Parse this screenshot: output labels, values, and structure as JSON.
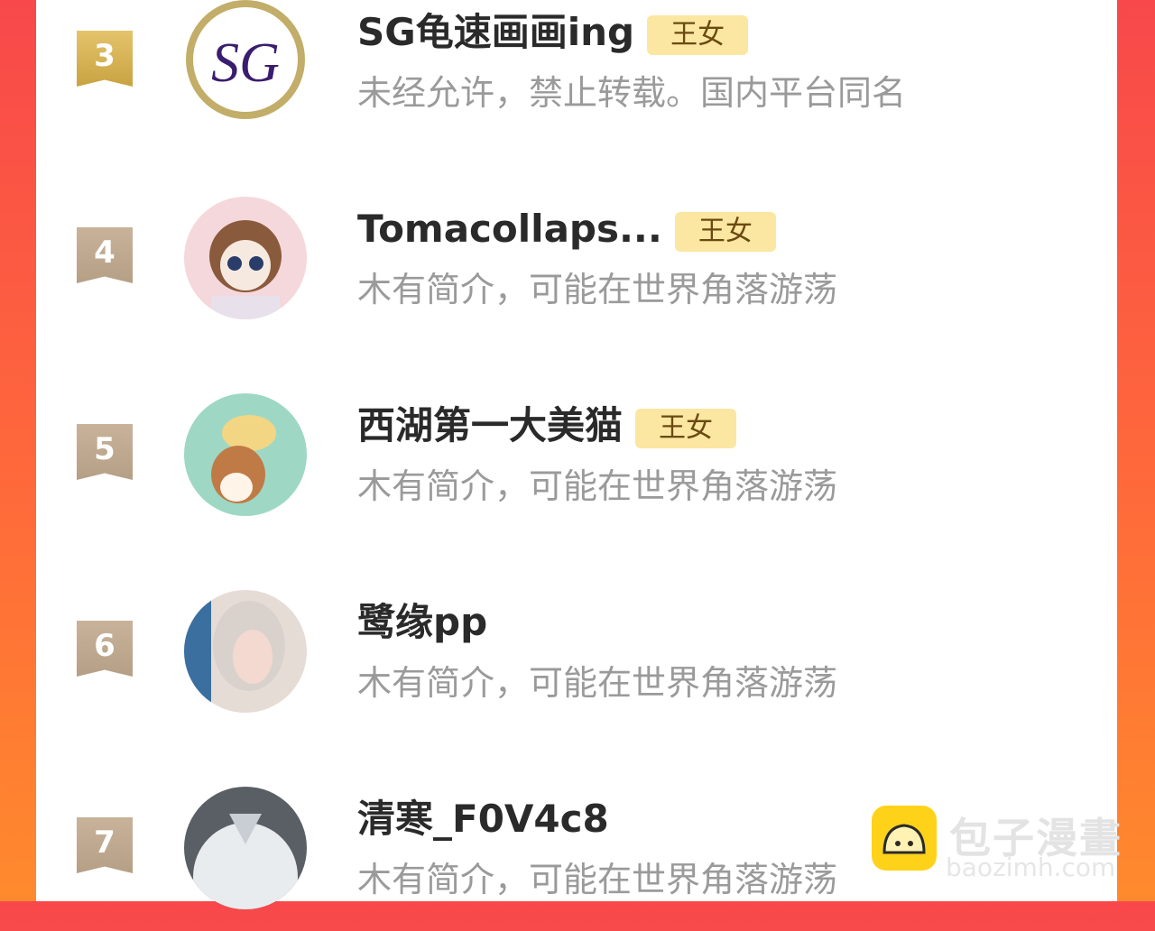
{
  "rows": [
    {
      "rank": "3",
      "name": "SG龟速画画ing",
      "badge": "王女",
      "bio": "未经允许，禁止转载。国内平台同名"
    },
    {
      "rank": "4",
      "name": "Tomacollaps...",
      "badge": "王女",
      "bio": "木有简介，可能在世界角落游荡"
    },
    {
      "rank": "5",
      "name": "西湖第一大美猫",
      "badge": "王女",
      "bio": "木有简介，可能在世界角落游荡"
    },
    {
      "rank": "6",
      "name": "鹭缘pp",
      "badge": "",
      "bio": "木有简介，可能在世界角落游荡"
    },
    {
      "rank": "7",
      "name": "清寒_F0V4c8",
      "badge": "",
      "bio": "木有简介，可能在世界角落游荡"
    }
  ],
  "watermark": {
    "title": "包子漫畫",
    "url": "baozimh.com"
  },
  "colors": {
    "accent": "#ff6a3a",
    "badge_bg": "#fbe7a1",
    "gold": "#c9a342"
  }
}
